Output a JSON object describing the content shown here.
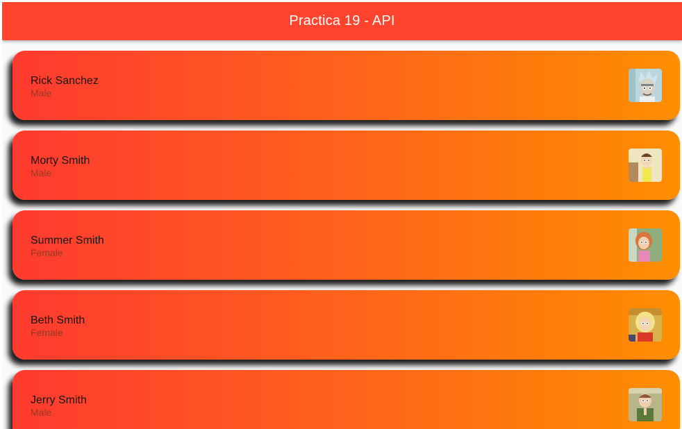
{
  "appbar": {
    "title": "Practica 19 - API",
    "color": "#ff432c"
  },
  "gradient": {
    "start": "#ff3a2f",
    "end": "#ff8e00"
  },
  "characters": [
    {
      "name": "Rick Sanchez",
      "gender": "Male",
      "avatar_icon": "rick-portrait-icon"
    },
    {
      "name": "Morty Smith",
      "gender": "Male",
      "avatar_icon": "morty-portrait-icon"
    },
    {
      "name": "Summer Smith",
      "gender": "Female",
      "avatar_icon": "summer-portrait-icon"
    },
    {
      "name": "Beth Smith",
      "gender": "Female",
      "avatar_icon": "beth-portrait-icon"
    },
    {
      "name": "Jerry Smith",
      "gender": "Male",
      "avatar_icon": "jerry-portrait-icon"
    }
  ]
}
